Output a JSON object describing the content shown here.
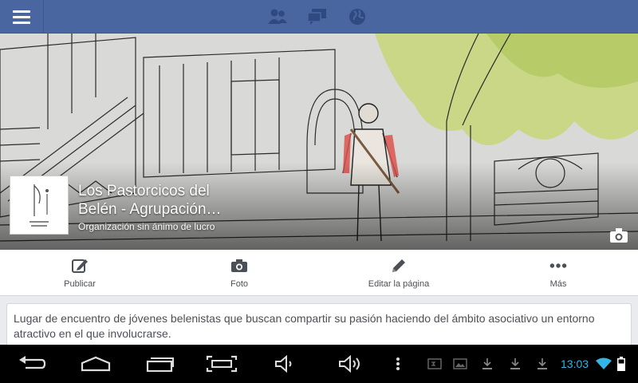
{
  "topbar": {
    "menu_icon": "hamburger-icon",
    "icons": [
      "friends-icon",
      "messages-icon",
      "globe-icon"
    ]
  },
  "page": {
    "name_line1": "Los Pastorcicos del",
    "name_line2": "Belén - Agrupación…",
    "category": "Organización sin ánimo de lucro"
  },
  "actions": [
    {
      "label": "Publicar",
      "icon": "compose-icon"
    },
    {
      "label": "Foto",
      "icon": "camera-icon"
    },
    {
      "label": "Editar la página",
      "icon": "pencil-icon"
    },
    {
      "label": "Más",
      "icon": "more-icon"
    }
  ],
  "about": {
    "text": "Lugar de encuentro de jóvenes belenistas que buscan compartir su pasión haciendo del ámbito asociativo un entorno atractivo en el que involucrarse."
  },
  "system": {
    "time": "13:03"
  },
  "colors": {
    "brand": "#4a66a0",
    "clock": "#33b5e5"
  }
}
